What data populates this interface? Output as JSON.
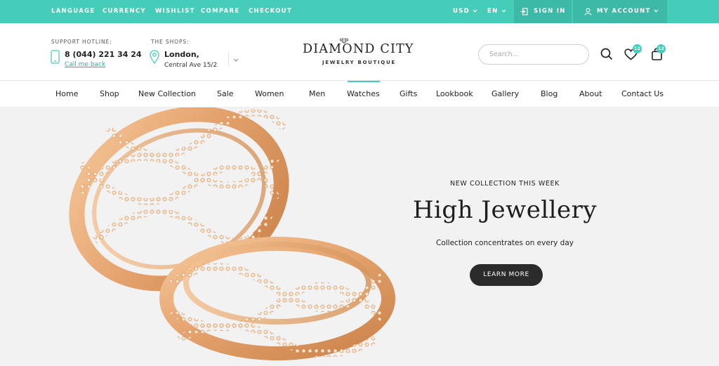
{
  "topbar": {
    "language": "LANGUAGE",
    "currency": "CURRENCY",
    "wishlist": "WISHLIST",
    "compare": "COMPARE",
    "checkout": "CHECKOUT",
    "currency_value": "USD",
    "language_value": "EN",
    "sign_in": "SIGN IN",
    "my_account": "MY ACCOUNT"
  },
  "header": {
    "hotline_label": "SUPPORT HOTLINE:",
    "hotline_number": "8 (044) 221 34 24",
    "call_me_back": "Call me back",
    "shops_label": "THE SHOPS:",
    "shop_city": "London,",
    "shop_address": "Central Ave 15/2",
    "logo_main": "DIAMOND CITY",
    "logo_sub": "JEWELRY BOUTIQUE",
    "search_placeholder": "Search...",
    "wishlist_count": "12",
    "cart_count": "12"
  },
  "nav": {
    "items": [
      "Home",
      "Shop",
      "New Collection",
      "Sale",
      "Women",
      "Men",
      "Watches",
      "Gifts",
      "Lookbook",
      "Gallery",
      "Blog",
      "About",
      "Contact Us"
    ],
    "active": "Watches"
  },
  "hero": {
    "kicker": "NEW COLLECTION THIS WEEK",
    "title": "High Jewellery",
    "subtitle": "Collection concentrates on every day",
    "button": "LEARN MORE"
  },
  "colors": {
    "accent": "#46cdb9",
    "accent_dark": "#3cb9a7",
    "button_dark": "#2b2b2b",
    "hero_bg": "#f2f2f2",
    "gold": "#e7a870"
  },
  "icons": [
    "caret-down-icon",
    "sign-in-icon",
    "user-icon",
    "phone-icon",
    "location-pin-icon",
    "diamond-icon",
    "search-icon",
    "heart-icon",
    "shopping-bag-icon"
  ]
}
